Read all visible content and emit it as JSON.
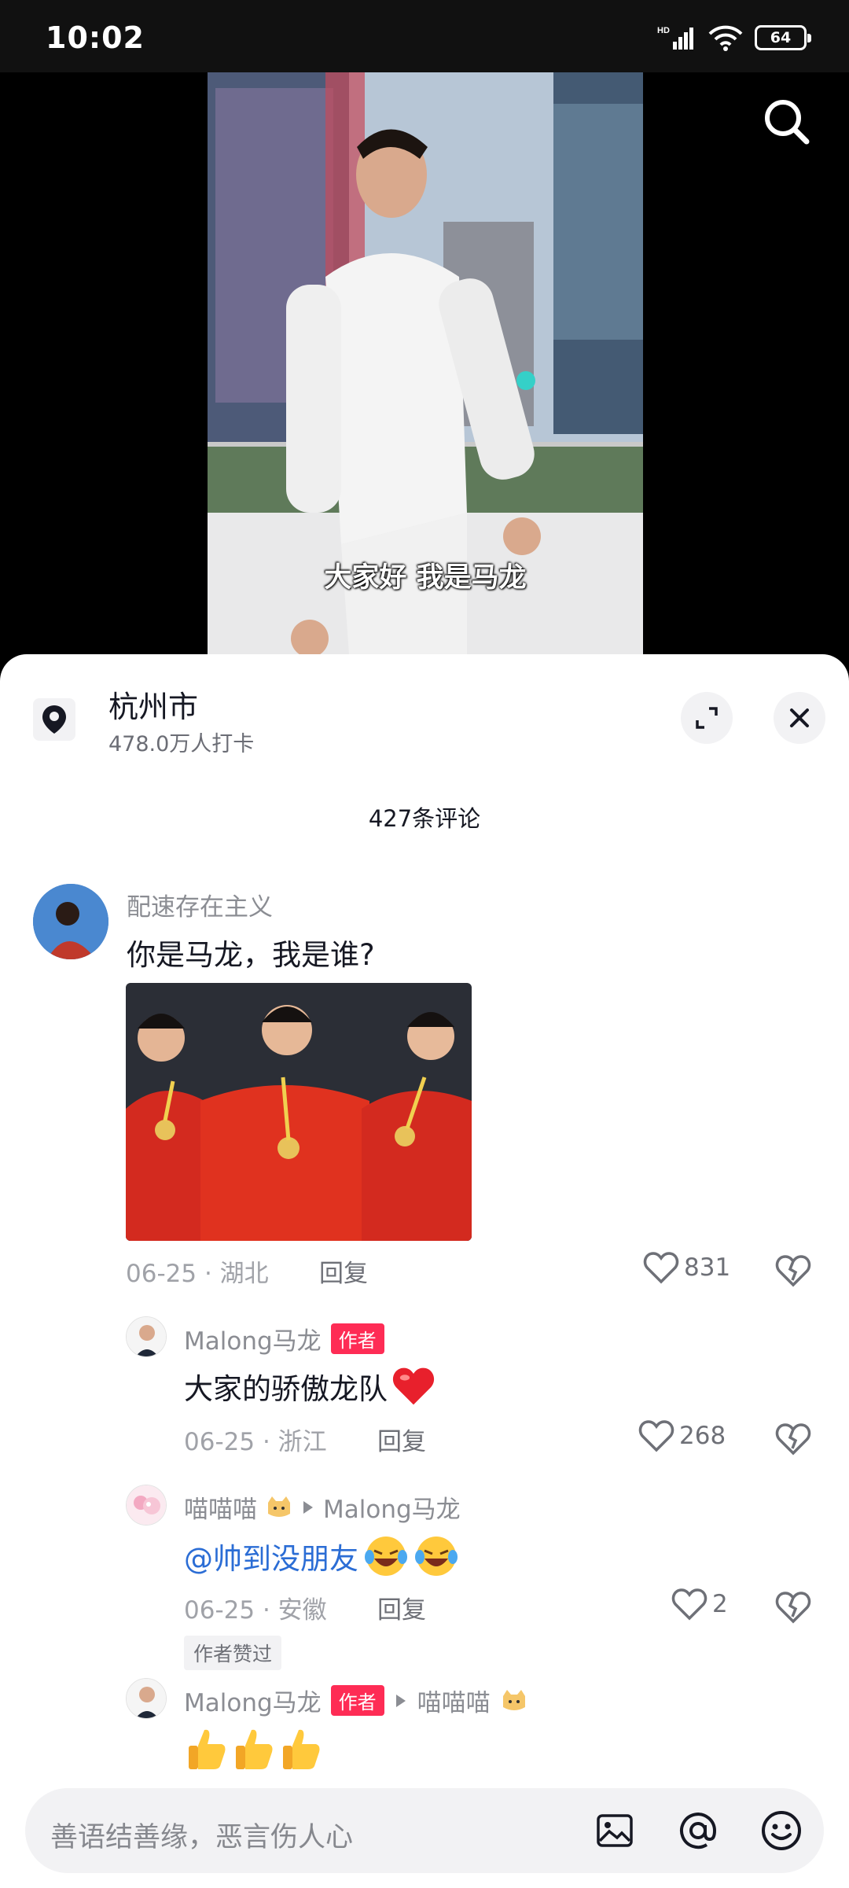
{
  "status_bar": {
    "time": "10:02",
    "network": "HD",
    "battery": "64"
  },
  "video": {
    "subtitle": "大家好  我是马龙"
  },
  "location": {
    "city": "杭州市",
    "checkins": "478.0万人打卡"
  },
  "comments_header": {
    "count_label": "427条评论"
  },
  "comments": [
    {
      "username": "配速存在主义",
      "text": "你是马龙，我是谁?",
      "date": "06-25",
      "region": "湖北",
      "reply_label": "回复",
      "likes": "831"
    }
  ],
  "replies": [
    {
      "username": "Malong马龙",
      "badge": "作者",
      "text": "大家的骄傲龙队",
      "date": "06-25",
      "region": "浙江",
      "reply_label": "回复",
      "likes": "268"
    },
    {
      "username": "喵喵喵",
      "reply_to": "Malong马龙",
      "text": "@帅到没朋友",
      "date": "06-25",
      "region": "安徽",
      "reply_label": "回复",
      "likes": "2",
      "tag": "作者赞过"
    },
    {
      "username": "Malong马龙",
      "badge": "作者",
      "reply_to": "喵喵喵"
    }
  ],
  "input": {
    "placeholder": "善语结善缘，恶言伤人心"
  },
  "icons": {
    "search": "search-icon",
    "location": "location-pin-icon",
    "expand": "expand-icon",
    "close": "close-icon",
    "like": "heart-outline-icon",
    "dislike": "broken-heart-icon",
    "image": "image-icon",
    "at": "at-icon",
    "emoji": "emoji-icon"
  },
  "colors": {
    "author_badge": "#fe2c55",
    "mention": "#2b6dd5"
  }
}
